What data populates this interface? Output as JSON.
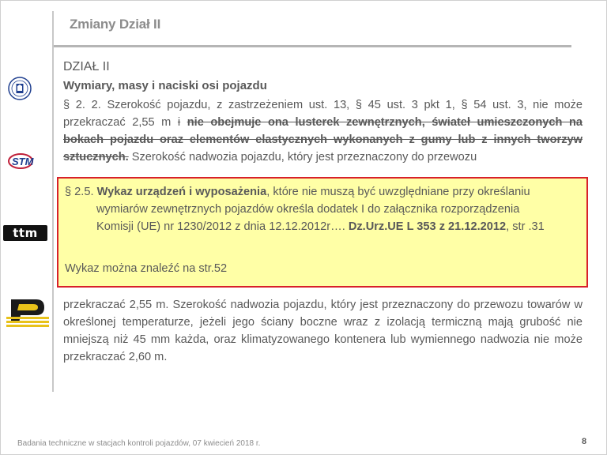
{
  "slide": {
    "title": "Zmiany Dział II",
    "footer": "Badania techniczne w stacjach kontroli pojazdów, 07 kwiecień 2018 r.",
    "page_number": "8"
  },
  "logos": {
    "ttm_text": "ttm"
  },
  "body": {
    "section_heading": "DZIAŁ II",
    "section_subheading": "Wymiary, masy i naciski osi pojazdu",
    "para1_start": "§ 2. 2. Szerokość pojazdu, z zastrzeżeniem ust. 13, § 45 ust. 3 pkt 1, § 54 ust. 3, nie może przekraczać 2,55 m ",
    "para1_strike_i": "i",
    "para1_space": " ",
    "para1_strike_bold": "nie obejmuje ona lusterek zewnętrznych, świateł umieszczonych na bokach pojazdu oraz elementów elastycznych wykonanych z gumy lub z innych tworzyw sztucznych.",
    "para1_end": " Szerokość nadwozia pojazdu, który jest przeznaczony do przewozu",
    "para2": "przekraczać 2,55 m. Szerokość nadwozia pojazdu, który jest przeznaczony do przewozu towarów w określonej temperaturze, jeżeli jego ściany boczne wraz z izolacją termiczną mają grubość nie mniejszą niż 45 mm każda, oraz klimatyzowanego kontenera lub wymiennego nadwozia nie może przekraczać 2,60 m."
  },
  "overlay": {
    "line1_prefix": "§ 2.5. ",
    "line1_bold": "Wykaz urządzeń i wyposażenia",
    "line1_rest": ", które nie muszą być uwzględniane przy określaniu",
    "line2": "wymiarów zewnętrznych pojazdów określa dodatek I do załącznika rozporządzenia",
    "line3_prefix": "Komisji (UE) nr 1230/2012 z dnia 12.12.2012r…. ",
    "line3_bold": "Dz.Urz.UE L 353 z 21.12.2012",
    "line3_rest": ", str .31",
    "note": "Wykaz można znaleźć na str.52",
    "colors": {
      "background": "#ffffa6",
      "border": "#d8202a"
    }
  }
}
